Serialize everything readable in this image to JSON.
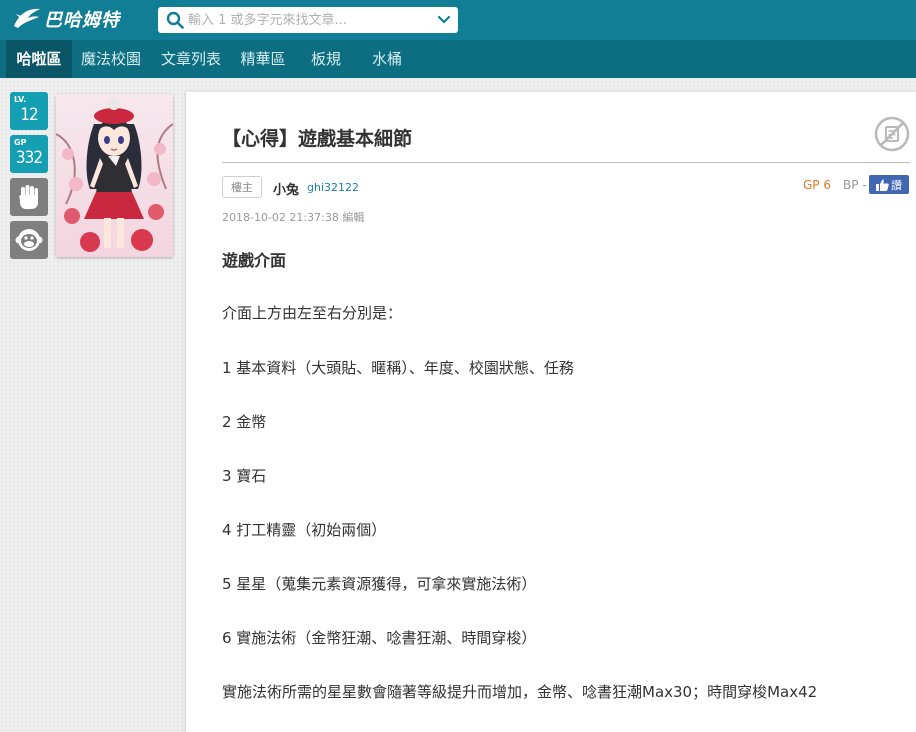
{
  "header": {
    "logo_text": "巴哈姆特",
    "search": {
      "placeholder": "輸入 1 或多字元來找文章...",
      "value": ""
    }
  },
  "nav": {
    "items": [
      {
        "label": "哈啦區",
        "active": true
      },
      {
        "label": "魔法校園",
        "active": false
      },
      {
        "label": "文章列表",
        "active": false
      },
      {
        "label": "精華區",
        "active": false
      },
      {
        "label": "板規",
        "active": false
      },
      {
        "label": "水桶",
        "active": false
      }
    ]
  },
  "sidebar": {
    "level": {
      "label": "LV.",
      "value": "12"
    },
    "gp": {
      "label": "GP",
      "value": "332"
    },
    "icons": [
      "fist-icon",
      "monkey-face-icon"
    ]
  },
  "post": {
    "title": "【心得】遊戲基本細節",
    "op_tag": "樓主",
    "author_name": "小兔",
    "author_id": "ghi32122",
    "gp_text": "GP 6",
    "bp_text": "BP -",
    "like_label": "讚",
    "timestamp": "2018-10-02 21:37:38",
    "edit_label": "編輯",
    "heading": "遊戲介面",
    "paragraphs": [
      "介面上方由左至右分別是：",
      "1 基本資料（大頭貼、暱稱）、年度、校園狀態、任務",
      "2 金幣",
      "3 寶石",
      "4 打工精靈（初始兩個）",
      "5 星星（蒐集元素資源獲得，可拿來實施法術）",
      "6 實施法術（金幣狂潮、唸書狂潮、時間穿梭）",
      "實施法術所需的星星數會隨著等級提升而增加，金幣、唸書狂潮Max30；時間穿梭Max42"
    ]
  },
  "colors": {
    "topbar": "#117e96",
    "navbar": "#0d6e82",
    "badge": "#14a0b2",
    "gp_orange": "#e3782a",
    "facebook": "#4267b2"
  }
}
